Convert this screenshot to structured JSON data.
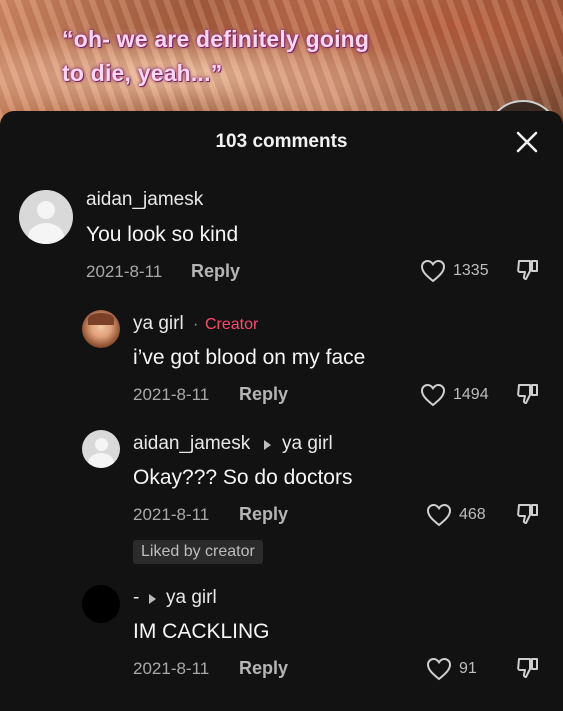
{
  "video": {
    "caption": "“oh- we are definitely going to die, yeah...”"
  },
  "header": {
    "comment_count": "103 comments"
  },
  "comments": [
    {
      "username": "aidan_jamesk",
      "text": "You look so kind",
      "date": "2021-8-11",
      "reply_label": "Reply",
      "likes": "1335",
      "avatar": "default-avatar"
    },
    {
      "username": "ya girl",
      "creator_separator": "·",
      "creator_tag": "Creator",
      "text": "i’ve got blood on my face",
      "date": "2021-8-11",
      "reply_label": "Reply",
      "likes": "1494",
      "avatar": "photo-avatar"
    },
    {
      "username": "aidan_jamesk",
      "reply_to": "ya girl",
      "text": "Okay??? So do doctors",
      "date": "2021-8-11",
      "reply_label": "Reply",
      "likes": "468",
      "liked_by_creator": "Liked by creator",
      "avatar": "default-avatar"
    },
    {
      "username": "-",
      "reply_to": "ya girl",
      "text": "IM CACKLING",
      "date": "2021-8-11",
      "reply_label": "Reply",
      "likes": "91",
      "avatar": "black-avatar"
    }
  ],
  "colors": {
    "sheet_background": "#121212",
    "creator_accent": "#fe4a6d",
    "caption_pink": "#ffd6f2"
  },
  "icons": [
    "close-icon",
    "heart-icon",
    "dislike-icon",
    "reply-arrow-icon"
  ]
}
